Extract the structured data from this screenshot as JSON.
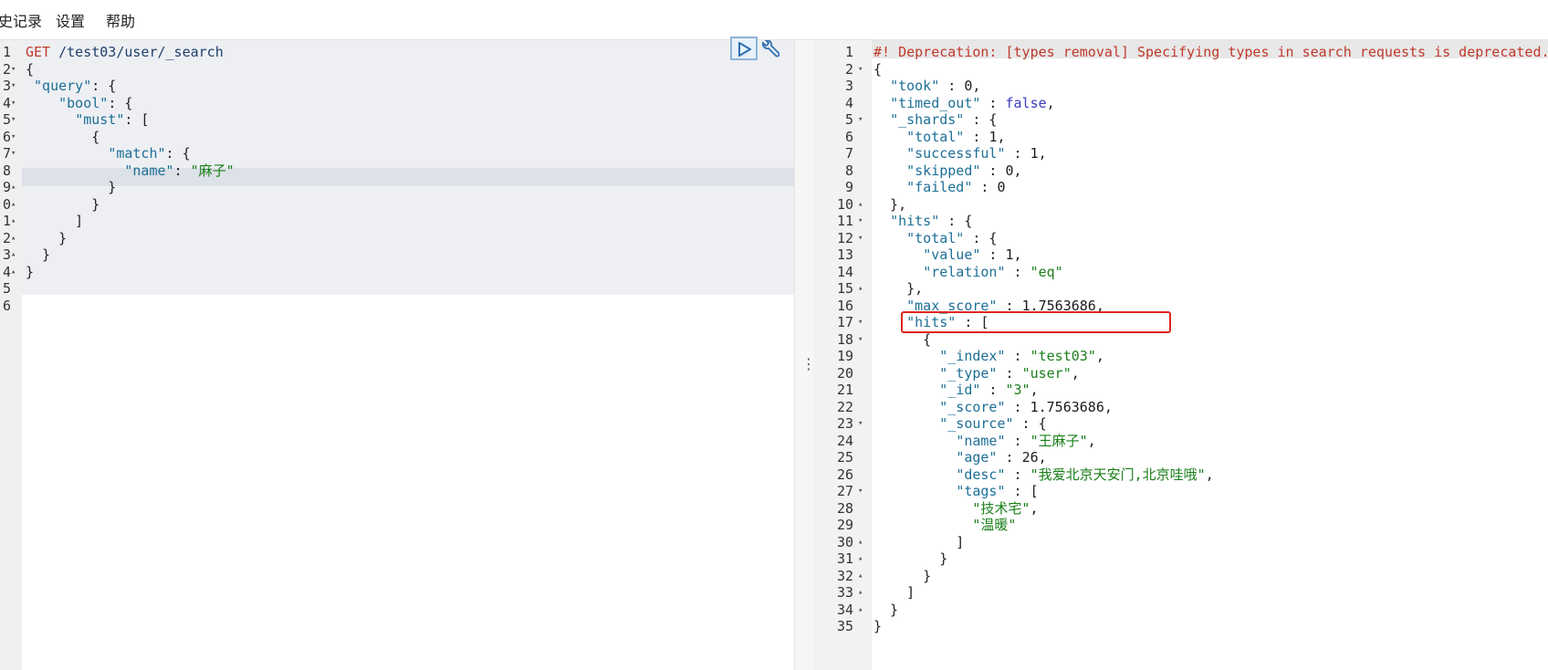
{
  "menu": {
    "history": "史记录",
    "settings": "设置",
    "help": "帮助"
  },
  "request": {
    "method": "GET",
    "path": "/test03/user/_search",
    "lines": [
      {
        "n": "1",
        "t": []
      },
      {
        "n": "2",
        "t": [
          [
            "p",
            "{"
          ]
        ]
      },
      {
        "n": "3",
        "t": [
          [
            "p",
            " "
          ],
          [
            "k",
            "\"query\""
          ],
          [
            "p",
            ": {"
          ]
        ]
      },
      {
        "n": "4",
        "t": [
          [
            "p",
            "    "
          ],
          [
            "k",
            "\"bool\""
          ],
          [
            "p",
            ": {"
          ]
        ]
      },
      {
        "n": "5",
        "t": [
          [
            "p",
            "      "
          ],
          [
            "k",
            "\"must\""
          ],
          [
            "p",
            ": ["
          ]
        ]
      },
      {
        "n": "6",
        "t": [
          [
            "p",
            "        {"
          ]
        ]
      },
      {
        "n": "7",
        "t": [
          [
            "p",
            "          "
          ],
          [
            "k",
            "\"match\""
          ],
          [
            "p",
            ": {"
          ]
        ]
      },
      {
        "n": "8",
        "t": [
          [
            "p",
            "            "
          ],
          [
            "k",
            "\"name\""
          ],
          [
            "p",
            ": "
          ],
          [
            "s",
            "\"麻子\""
          ]
        ]
      },
      {
        "n": "9",
        "t": [
          [
            "p",
            "          }"
          ]
        ]
      },
      {
        "n": "0",
        "t": [
          [
            "p",
            "        }"
          ]
        ]
      },
      {
        "n": "1",
        "t": [
          [
            "p",
            "      ]"
          ]
        ]
      },
      {
        "n": "2",
        "t": [
          [
            "p",
            "    }"
          ]
        ]
      },
      {
        "n": "3",
        "t": [
          [
            "p",
            "  }"
          ]
        ]
      },
      {
        "n": "4",
        "t": [
          [
            "p",
            "}"
          ]
        ]
      },
      {
        "n": "5",
        "t": []
      },
      {
        "n": "6",
        "t": []
      }
    ],
    "folds": [
      "",
      "▾",
      "▾",
      "▾",
      "▾",
      "▾",
      "▾",
      "",
      "▴",
      "▴",
      "▴",
      "▴",
      "▴",
      "▴",
      "",
      ""
    ]
  },
  "response": {
    "lines": [
      {
        "n": "1",
        "t": [
          [
            "m",
            "#! Deprecation: [types removal] Specifying types in search requests is deprecated."
          ]
        ]
      },
      {
        "n": "2",
        "t": [
          [
            "p",
            "{"
          ]
        ]
      },
      {
        "n": "3",
        "t": [
          [
            "p",
            "  "
          ],
          [
            "k",
            "\"took\""
          ],
          [
            "p",
            " : "
          ],
          [
            "n",
            "0"
          ],
          [
            "p",
            ","
          ]
        ]
      },
      {
        "n": "4",
        "t": [
          [
            "p",
            "  "
          ],
          [
            "k",
            "\"timed_out\""
          ],
          [
            "p",
            " : "
          ],
          [
            "b",
            "false"
          ],
          [
            "p",
            ","
          ]
        ]
      },
      {
        "n": "5",
        "t": [
          [
            "p",
            "  "
          ],
          [
            "k",
            "\"_shards\""
          ],
          [
            "p",
            " : {"
          ]
        ]
      },
      {
        "n": "6",
        "t": [
          [
            "p",
            "    "
          ],
          [
            "k",
            "\"total\""
          ],
          [
            "p",
            " : "
          ],
          [
            "n",
            "1"
          ],
          [
            "p",
            ","
          ]
        ]
      },
      {
        "n": "7",
        "t": [
          [
            "p",
            "    "
          ],
          [
            "k",
            "\"successful\""
          ],
          [
            "p",
            " : "
          ],
          [
            "n",
            "1"
          ],
          [
            "p",
            ","
          ]
        ]
      },
      {
        "n": "8",
        "t": [
          [
            "p",
            "    "
          ],
          [
            "k",
            "\"skipped\""
          ],
          [
            "p",
            " : "
          ],
          [
            "n",
            "0"
          ],
          [
            "p",
            ","
          ]
        ]
      },
      {
        "n": "9",
        "t": [
          [
            "p",
            "    "
          ],
          [
            "k",
            "\"failed\""
          ],
          [
            "p",
            " : "
          ],
          [
            "n",
            "0"
          ]
        ]
      },
      {
        "n": "10",
        "t": [
          [
            "p",
            "  },"
          ]
        ]
      },
      {
        "n": "11",
        "t": [
          [
            "p",
            "  "
          ],
          [
            "k",
            "\"hits\""
          ],
          [
            "p",
            " : {"
          ]
        ]
      },
      {
        "n": "12",
        "t": [
          [
            "p",
            "    "
          ],
          [
            "k",
            "\"total\""
          ],
          [
            "p",
            " : {"
          ]
        ]
      },
      {
        "n": "13",
        "t": [
          [
            "p",
            "      "
          ],
          [
            "k",
            "\"value\""
          ],
          [
            "p",
            " : "
          ],
          [
            "n",
            "1"
          ],
          [
            "p",
            ","
          ]
        ]
      },
      {
        "n": "14",
        "t": [
          [
            "p",
            "      "
          ],
          [
            "k",
            "\"relation\""
          ],
          [
            "p",
            " : "
          ],
          [
            "s",
            "\"eq\""
          ]
        ]
      },
      {
        "n": "15",
        "t": [
          [
            "p",
            "    },"
          ]
        ]
      },
      {
        "n": "16",
        "t": [
          [
            "p",
            "    "
          ],
          [
            "k",
            "\"max_score\""
          ],
          [
            "p",
            " : "
          ],
          [
            "n",
            "1.7563686"
          ],
          [
            "p",
            ","
          ]
        ]
      },
      {
        "n": "17",
        "t": [
          [
            "p",
            "    "
          ],
          [
            "k",
            "\"hits\""
          ],
          [
            "p",
            " : ["
          ]
        ]
      },
      {
        "n": "18",
        "t": [
          [
            "p",
            "      {"
          ]
        ]
      },
      {
        "n": "19",
        "t": [
          [
            "p",
            "        "
          ],
          [
            "k",
            "\"_index\""
          ],
          [
            "p",
            " : "
          ],
          [
            "s",
            "\"test03\""
          ],
          [
            "p",
            ","
          ]
        ]
      },
      {
        "n": "20",
        "t": [
          [
            "p",
            "        "
          ],
          [
            "k",
            "\"_type\""
          ],
          [
            "p",
            " : "
          ],
          [
            "s",
            "\"user\""
          ],
          [
            "p",
            ","
          ]
        ]
      },
      {
        "n": "21",
        "t": [
          [
            "p",
            "        "
          ],
          [
            "k",
            "\"_id\""
          ],
          [
            "p",
            " : "
          ],
          [
            "s",
            "\"3\""
          ],
          [
            "p",
            ","
          ]
        ]
      },
      {
        "n": "22",
        "t": [
          [
            "p",
            "        "
          ],
          [
            "k",
            "\"_score\""
          ],
          [
            "p",
            " : "
          ],
          [
            "n",
            "1.7563686"
          ],
          [
            "p",
            ","
          ]
        ]
      },
      {
        "n": "23",
        "t": [
          [
            "p",
            "        "
          ],
          [
            "k",
            "\"_source\""
          ],
          [
            "p",
            " : {"
          ]
        ]
      },
      {
        "n": "24",
        "t": [
          [
            "p",
            "          "
          ],
          [
            "k",
            "\"name\""
          ],
          [
            "p",
            " : "
          ],
          [
            "s",
            "\"王麻子\""
          ],
          [
            "p",
            ","
          ]
        ]
      },
      {
        "n": "25",
        "t": [
          [
            "p",
            "          "
          ],
          [
            "k",
            "\"age\""
          ],
          [
            "p",
            " : "
          ],
          [
            "n",
            "26"
          ],
          [
            "p",
            ","
          ]
        ]
      },
      {
        "n": "26",
        "t": [
          [
            "p",
            "          "
          ],
          [
            "k",
            "\"desc\""
          ],
          [
            "p",
            " : "
          ],
          [
            "s",
            "\"我爱北京天安门,北京哇哦\""
          ],
          [
            "p",
            ","
          ]
        ]
      },
      {
        "n": "27",
        "t": [
          [
            "p",
            "          "
          ],
          [
            "k",
            "\"tags\""
          ],
          [
            "p",
            " : ["
          ]
        ]
      },
      {
        "n": "28",
        "t": [
          [
            "p",
            "            "
          ],
          [
            "s",
            "\"技术宅\""
          ],
          [
            "p",
            ","
          ]
        ]
      },
      {
        "n": "29",
        "t": [
          [
            "p",
            "            "
          ],
          [
            "s",
            "\"温暖\""
          ]
        ]
      },
      {
        "n": "30",
        "t": [
          [
            "p",
            "          ]"
          ]
        ]
      },
      {
        "n": "31",
        "t": [
          [
            "p",
            "        }"
          ]
        ]
      },
      {
        "n": "32",
        "t": [
          [
            "p",
            "      }"
          ]
        ]
      },
      {
        "n": "33",
        "t": [
          [
            "p",
            "    ]"
          ]
        ]
      },
      {
        "n": "34",
        "t": [
          [
            "p",
            "  }"
          ]
        ]
      },
      {
        "n": "35",
        "t": [
          [
            "p",
            "}"
          ]
        ]
      }
    ],
    "folds": [
      "",
      "▾",
      "",
      "",
      "▾",
      "",
      "",
      "",
      "",
      "▴",
      "▾",
      "▾",
      "",
      "",
      "▴",
      "",
      "▾",
      "▾",
      "",
      "",
      "",
      "",
      "▾",
      "",
      "",
      "",
      "▾",
      "",
      "",
      "▴",
      "▴",
      "▴",
      "▴",
      "▴",
      ""
    ]
  },
  "colors": {
    "highlight": "#e0261f",
    "key": "#1d6f96",
    "string": "#1a7f1a"
  }
}
